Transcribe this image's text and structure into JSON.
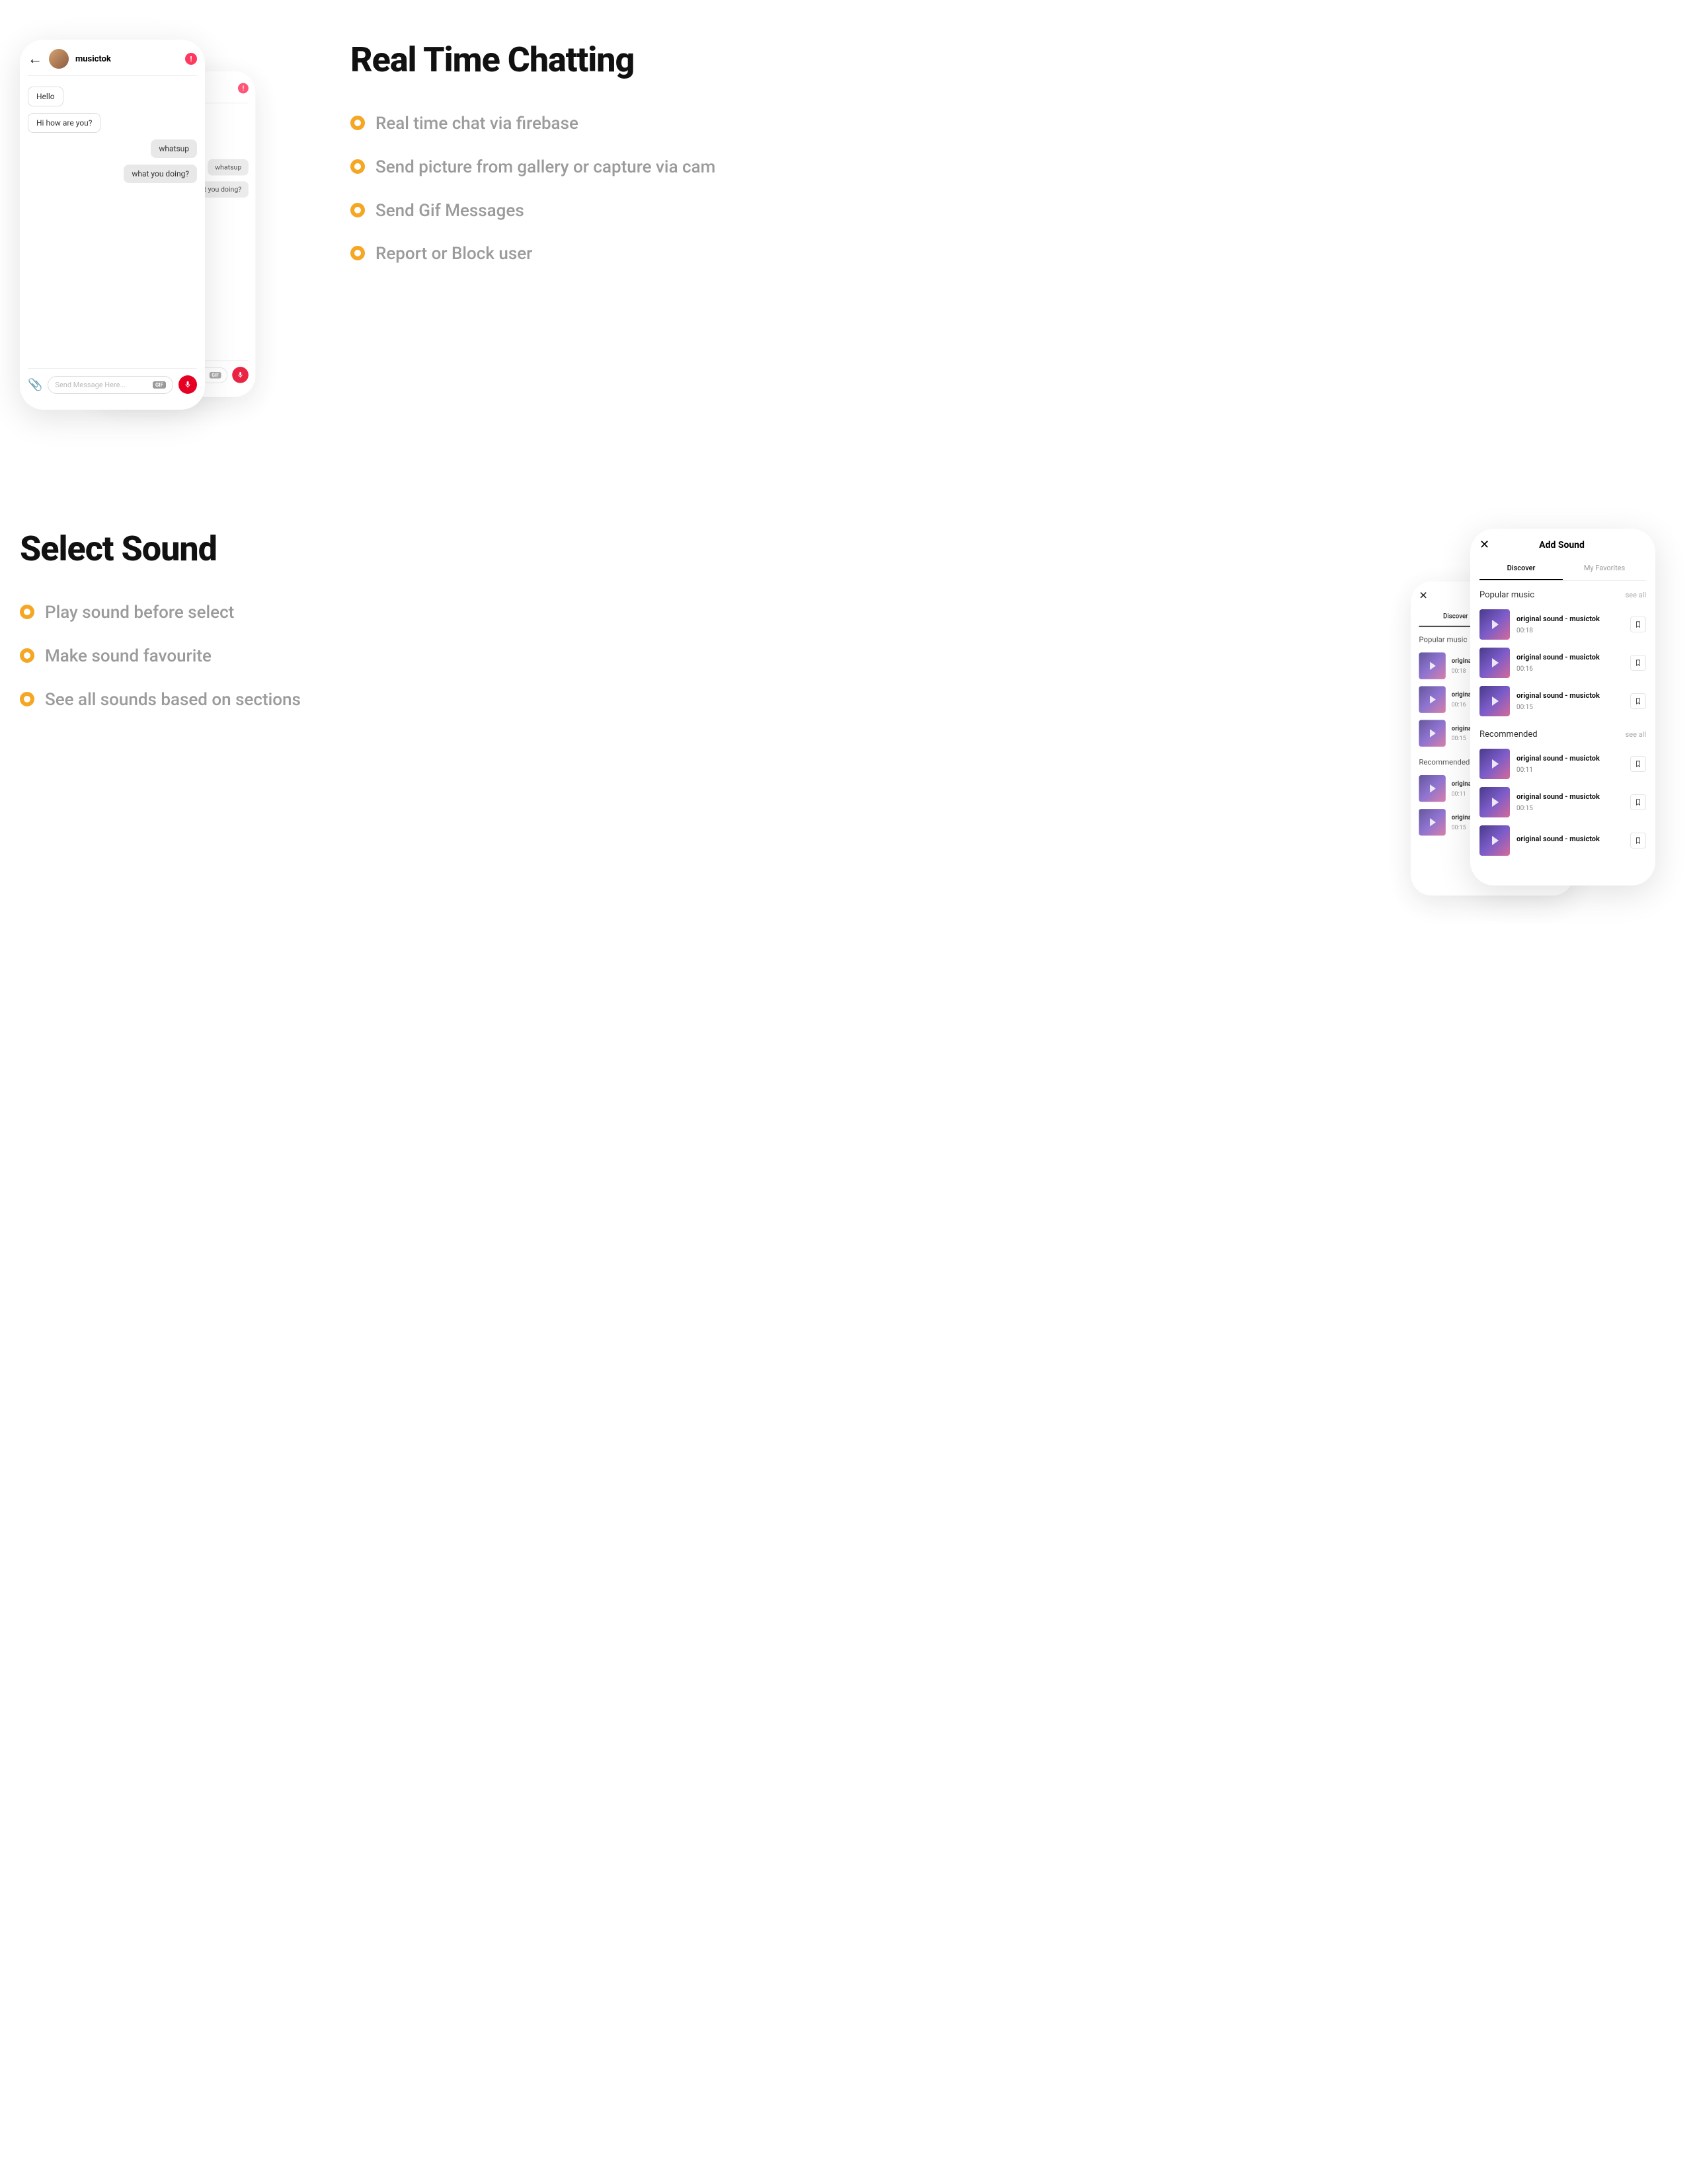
{
  "section1": {
    "title": "Real Time Chatting",
    "features": [
      "Real time chat via firebase",
      "Send picture from gallery or capture via cam",
      "Send Gif Messages",
      "Report or Block user"
    ],
    "chat": {
      "username": "musictok",
      "messages_left": [
        "Hello",
        "Hi how are you?"
      ],
      "messages_right": [
        "whatsup",
        "what you doing?"
      ],
      "input_placeholder": "Send Message Here...",
      "gif_label": "GIF"
    }
  },
  "section2": {
    "title": "Select Sound",
    "features": [
      "Play sound before select",
      "Make sound favourite",
      "See all sounds based on sections"
    ],
    "sound": {
      "header_title": "Add Sound",
      "tabs": [
        "Discover",
        "My Favorites"
      ],
      "see_all": "see all",
      "popular_label": "Popular music",
      "recommended_label": "Recommended",
      "popular": [
        {
          "name": "original sound - musictok",
          "dur": "00:18"
        },
        {
          "name": "original sound - musictok",
          "dur": "00:16"
        },
        {
          "name": "original sound - musictok",
          "dur": "00:15"
        }
      ],
      "recommended": [
        {
          "name": "original sound - musictok",
          "dur": "00:11"
        },
        {
          "name": "original sound - musictok",
          "dur": "00:15"
        },
        {
          "name": "original sound - musictok",
          "dur": ""
        }
      ]
    }
  }
}
